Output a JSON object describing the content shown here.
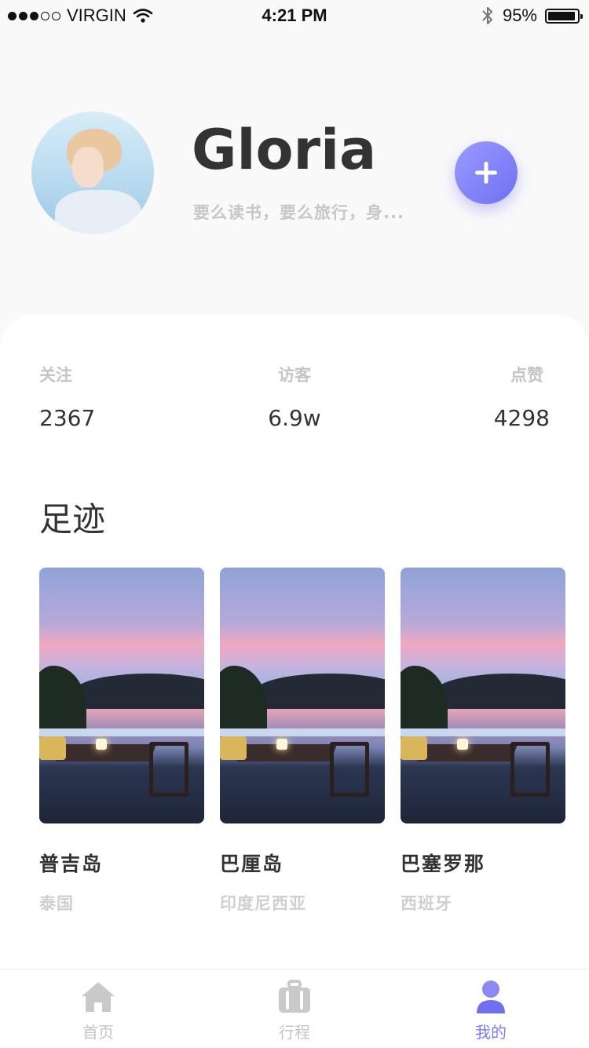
{
  "status_bar": {
    "carrier": "VIRGIN",
    "time": "4:21 PM",
    "battery": "95%",
    "battery_level": 0.95,
    "signal_bars_filled": 3,
    "signal_bars_total": 5
  },
  "profile": {
    "name": "Gloria",
    "bio": "要么读书，要么旅行，身...",
    "add_button_icon": "plus-icon"
  },
  "stats": [
    {
      "label": "关注",
      "value": "2367"
    },
    {
      "label": "访客",
      "value": "6.9w"
    },
    {
      "label": "点赞",
      "value": "4298"
    }
  ],
  "footprints": {
    "title": "足迹",
    "items": [
      {
        "name": "普吉岛",
        "country": "泰国"
      },
      {
        "name": "巴厘岛",
        "country": "印度尼西亚"
      },
      {
        "name": "巴塞罗那",
        "country": "西班牙"
      }
    ]
  },
  "tabs": [
    {
      "label": "首页",
      "icon": "home-icon",
      "active": false
    },
    {
      "label": "行程",
      "icon": "suitcase-icon",
      "active": false
    },
    {
      "label": "我的",
      "icon": "user-icon",
      "active": true
    }
  ],
  "colors": {
    "accent": "#7c7cf0",
    "inactive": "#c3c3c3"
  }
}
